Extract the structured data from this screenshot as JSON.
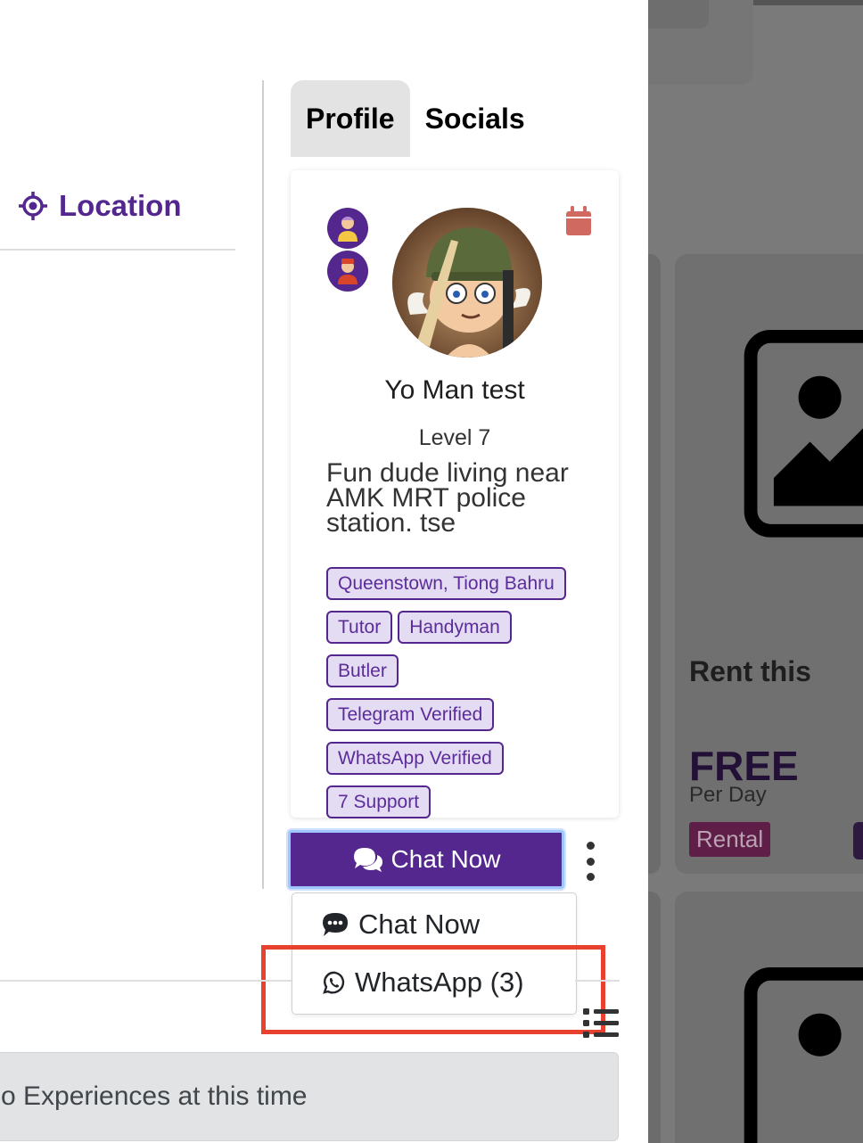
{
  "location": {
    "label": "Location",
    "icon": "crosshair-icon"
  },
  "tabs": [
    {
      "label": "Profile",
      "active": true
    },
    {
      "label": "Socials",
      "active": false
    }
  ],
  "profile": {
    "name": "Yo Man test",
    "level": "Level 7",
    "bio": "Fun dude living near AMK MRT police station. tse",
    "tags": [
      "Queenstown, Tiong Bahru",
      "Tutor",
      "Handyman",
      "Butler",
      "Telegram Verified",
      "WhatsApp Verified",
      "7 Support"
    ]
  },
  "actions": {
    "chat_now": "Chat Now",
    "dropdown": [
      {
        "label": "Chat Now",
        "icon": "comment-dots-icon"
      },
      {
        "label": "WhatsApp (3)",
        "icon": "whatsapp-icon"
      }
    ]
  },
  "experiences": {
    "empty_message": "o Experiences at this time"
  },
  "background_listing": {
    "title": "Rent this",
    "price": "FREE",
    "period": "Per Day",
    "category": "Rental"
  },
  "colors": {
    "brand_purple": "#54278f",
    "tag_bg": "#e4dcf2",
    "highlight_red": "#e8412f",
    "calendar_icon": "#d0695f"
  }
}
